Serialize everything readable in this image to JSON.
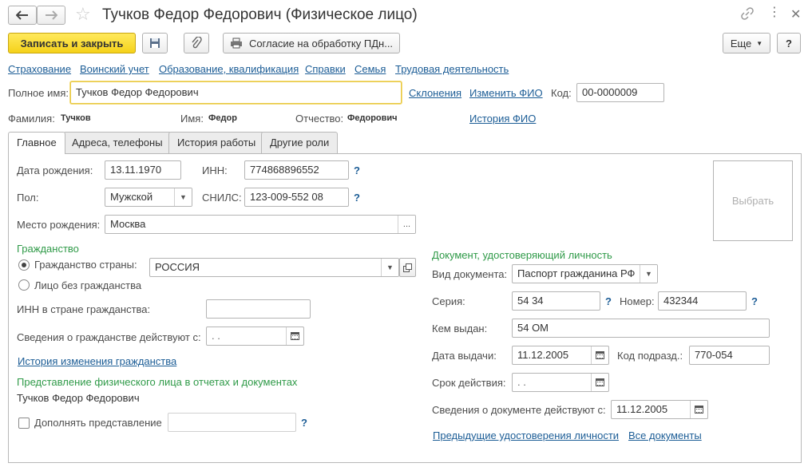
{
  "window": {
    "title": "Тучков Федор Федорович (Физическое лицо)"
  },
  "toolbar": {
    "save_close_label": "Записать и закрыть",
    "consent_label": "Согласие на обработку ПДн...",
    "more_label": "Еще",
    "help_label": "?"
  },
  "nav_links": [
    "Страхование",
    "Воинский учет",
    "Образование, квалификация",
    "Справки",
    "Семья",
    "Трудовая деятельность"
  ],
  "header": {
    "full_name_label": "Полное имя:",
    "full_name_value": "Тучков Федор Федорович",
    "declension_link": "Склонения",
    "change_fio_link": "Изменить ФИО",
    "code_label": "Код:",
    "code_value": "00-0000009",
    "surname_label": "Фамилия:",
    "surname_value": "Тучков",
    "name_label": "Имя:",
    "name_value": "Федор",
    "patronymic_label": "Отчество:",
    "patronymic_value": "Федорович",
    "fio_history_link": "История ФИО"
  },
  "tabs": [
    "Главное",
    "Адреса, телефоны",
    "История работы",
    "Другие роли"
  ],
  "main": {
    "birth_date_label": "Дата рождения:",
    "birth_date_value": "13.11.1970",
    "inn_label": "ИНН:",
    "inn_value": "774868896552",
    "gender_label": "Пол:",
    "gender_value": "Мужской",
    "snils_label": "СНИЛС:",
    "snils_value": "123-009-552 08",
    "birth_place_label": "Место рождения:",
    "birth_place_value": "Москва",
    "ellipsis": "...",
    "photo_label": "Выбрать",
    "help_mark": "?"
  },
  "citizenship": {
    "section_title": "Гражданство",
    "country_option": "Гражданство страны:",
    "country_value": "РОССИЯ",
    "stateless_option": "Лицо без гражданства",
    "inn_country_label": "ИНН в стране гражданства:",
    "valid_from_label": "Сведения о гражданстве действуют с:",
    "valid_from_value": " .  .",
    "history_link": "История изменения гражданства"
  },
  "representation": {
    "section_title": "Представление физического лица в отчетах и документах",
    "value": "Тучков Федор Федорович",
    "supplement_label": "Дополнять представление"
  },
  "identity_doc": {
    "section_title": "Документ, удостоверяющий личность",
    "doc_type_label": "Вид документа:",
    "doc_type_value": "Паспорт гражданина РФ",
    "series_label": "Серия:",
    "series_value": "54 34",
    "number_label": "Номер:",
    "number_value": "432344",
    "issued_by_label": "Кем выдан:",
    "issued_by_value": "54 ОМ",
    "issue_date_label": "Дата выдачи:",
    "issue_date_value": "11.12.2005",
    "subdivision_label": "Код подразд.:",
    "subdivision_value": "770-054",
    "validity_label": "Срок действия:",
    "validity_value": " .  .",
    "valid_from_label": "Сведения о документе действуют с:",
    "valid_from_value": "11.12.2005",
    "prev_docs_link": "Предыдущие удостоверения личности",
    "all_docs_link": "Все документы"
  }
}
